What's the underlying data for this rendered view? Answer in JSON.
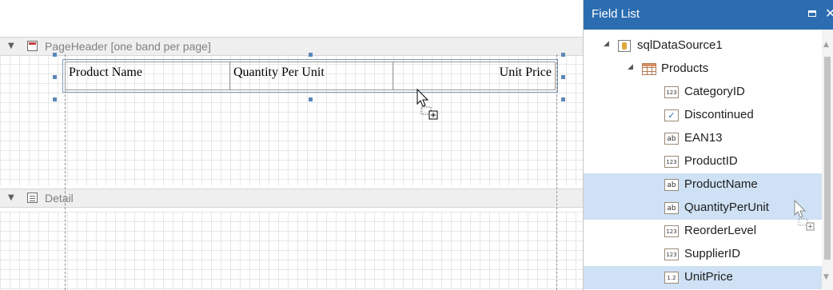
{
  "designer": {
    "page_header_band": {
      "label": "PageHeader [one band per page]",
      "icon": "page-header-band-icon"
    },
    "detail_band": {
      "label": "Detail",
      "icon": "detail-band-icon"
    },
    "header_table": {
      "cells": [
        "Product Name",
        "Quantity Per Unit",
        "Unit Price"
      ]
    }
  },
  "field_list": {
    "title": "Field List",
    "data_source": "sqlDataSource1",
    "table": "Products",
    "fields": [
      {
        "name": "CategoryID",
        "type": "num",
        "selected": false
      },
      {
        "name": "Discontinued",
        "type": "chk",
        "selected": false
      },
      {
        "name": "EAN13",
        "type": "txt",
        "selected": false
      },
      {
        "name": "ProductID",
        "type": "num",
        "selected": false
      },
      {
        "name": "ProductName",
        "type": "txt",
        "selected": true
      },
      {
        "name": "QuantityPerUnit",
        "type": "txt",
        "selected": true
      },
      {
        "name": "ReorderLevel",
        "type": "num",
        "selected": false
      },
      {
        "name": "SupplierID",
        "type": "num",
        "selected": false
      },
      {
        "name": "UnitPrice",
        "type": "dec",
        "selected": true
      }
    ]
  },
  "colors": {
    "panel_header": "#2b6db0",
    "selection": "#cfe1f4",
    "handle": "#5b86b8"
  }
}
